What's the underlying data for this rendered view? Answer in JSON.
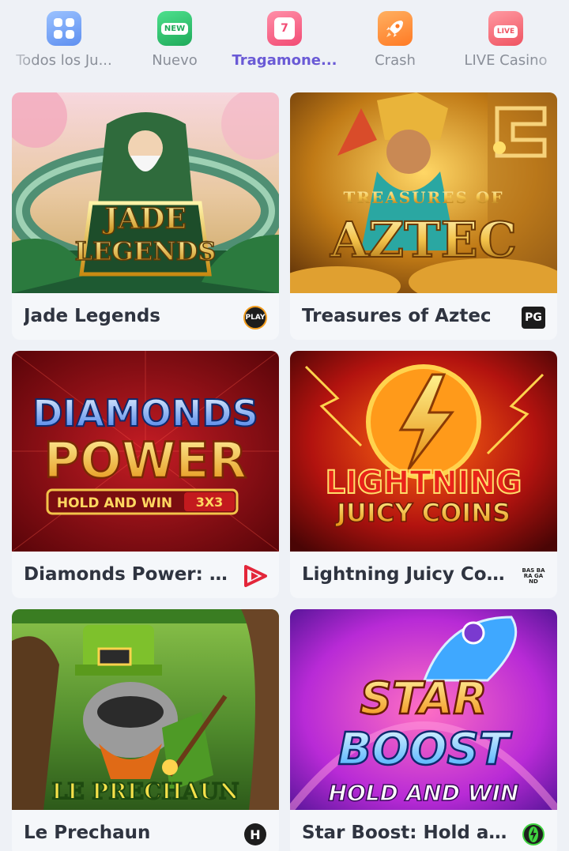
{
  "tabs": [
    {
      "label": "Todos los Ju...",
      "icon": "grid-icon",
      "active": false
    },
    {
      "label": "Nuevo",
      "icon": "new-badge-icon",
      "active": false
    },
    {
      "label": "Tragamone...",
      "icon": "slot-machine-icon",
      "active": true
    },
    {
      "label": "Crash",
      "icon": "rocket-icon",
      "active": false
    },
    {
      "label": "LIVE Casino",
      "icon": "live-tv-icon",
      "active": false
    }
  ],
  "tab_icon_text": {
    "new": "NEW",
    "slot": "7",
    "live": "LIVE"
  },
  "games": [
    {
      "title": "Jade Legends",
      "art_title_line1": "JADE",
      "art_title_line2": "LEGENDS",
      "provider_icon": "playson-logo-icon",
      "provider_text": "PLAY"
    },
    {
      "title": "Treasures of Aztec",
      "art_title_line1": "TREASURES OF",
      "art_title_line2": "AZTEC",
      "provider_icon": "pg-soft-logo-icon",
      "provider_text": "PG"
    },
    {
      "title": "Diamonds Power: Hol...",
      "art_title_line1": "DIAMONDS",
      "art_title_line2": "POWER",
      "art_title_line3": "HOLD AND WIN",
      "art_title_badge": "3X3",
      "provider_icon": "play-triangle-logo-icon",
      "provider_text": ""
    },
    {
      "title": "Lightning Juicy Coins",
      "art_title_line1": "LIGHTNING",
      "art_title_line2": "JUICY COINS",
      "provider_icon": "bgaming-logo-icon",
      "provider_text": "BAS BARA GAND"
    },
    {
      "title": "Le Prechaun",
      "art_title_line1": "LE PRECHAUN",
      "provider_icon": "hacksaw-logo-icon",
      "provider_text": "H"
    },
    {
      "title": "Star Boost: Hold and...",
      "art_title_line1": "STAR",
      "art_title_line2": "BOOST",
      "art_title_line3": "HOLD AND WIN",
      "provider_icon": "bolt-circle-logo-icon",
      "provider_text": ""
    }
  ],
  "colors": {
    "background": "#eef1f6",
    "card": "#f5f7fa",
    "active_tab": "#6a5ad6",
    "inactive_tab": "#8a8f99",
    "title": "#2f3440"
  }
}
